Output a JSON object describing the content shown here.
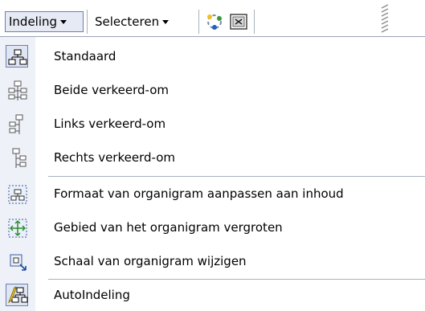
{
  "toolbar": {
    "layout_label": "Indeling",
    "select_label": "Selecteren",
    "icons": [
      "autoformat-icon",
      "fit-text-icon"
    ]
  },
  "menu": {
    "items": [
      {
        "label": "Standaard",
        "icon": "standard-layout-icon",
        "selected": true
      },
      {
        "label": "Beide verkeerd-om",
        "icon": "both-hanging-icon"
      },
      {
        "label": "Links verkeerd-om",
        "icon": "left-hanging-icon"
      },
      {
        "label": "Rechts verkeerd-om",
        "icon": "right-hanging-icon"
      },
      {
        "label": "Formaat van organigram aanpassen aan inhoud",
        "icon": "fit-to-contents-icon"
      },
      {
        "label": "Gebied van het organigram vergroten",
        "icon": "expand-organization-chart-icon"
      },
      {
        "label": "Schaal van organigram wijzigen",
        "icon": "scale-organization-chart-icon"
      },
      {
        "label": "AutoIndeling",
        "icon": "autolayout-icon",
        "selected": true
      }
    ]
  },
  "colors": {
    "highlight_border": "#6b7fb0",
    "highlight_fill": "#dfe5f3",
    "icon_column": "#eef1f7"
  }
}
